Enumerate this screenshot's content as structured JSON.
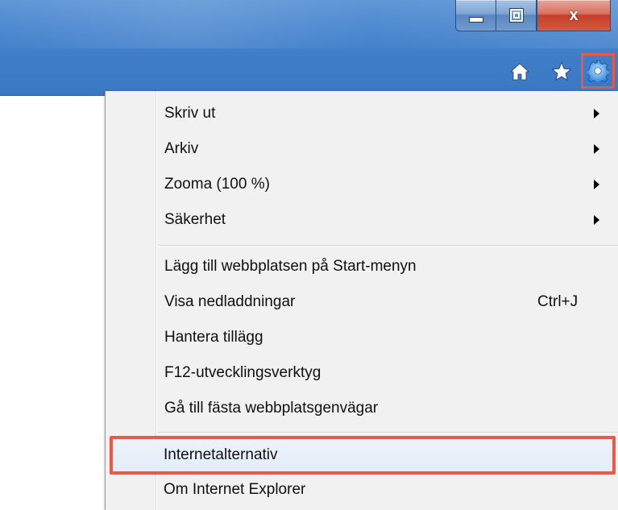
{
  "window": {
    "close_label": "x"
  },
  "toolbar": {
    "icons": [
      "home-icon",
      "star-icon",
      "gear-icon"
    ],
    "highlight_color": "#e8594a"
  },
  "menu": {
    "items": [
      {
        "label": "Skriv ut",
        "submenu": true
      },
      {
        "label": "Arkiv",
        "submenu": true
      },
      {
        "label": "Zooma (100 %)",
        "submenu": true
      },
      {
        "label": "Säkerhet",
        "submenu": true
      },
      {
        "label": "Lägg till webbplatsen på Start-menyn"
      },
      {
        "label": "Visa nedladdningar",
        "shortcut": "Ctrl+J"
      },
      {
        "label": "Hantera tillägg"
      },
      {
        "label": "F12-utvecklingsverktyg"
      },
      {
        "label": "Gå till fästa webbplatsgenvägar"
      },
      {
        "label": "Internetalternativ",
        "highlighted": true
      },
      {
        "label": "Om Internet Explorer"
      }
    ]
  }
}
